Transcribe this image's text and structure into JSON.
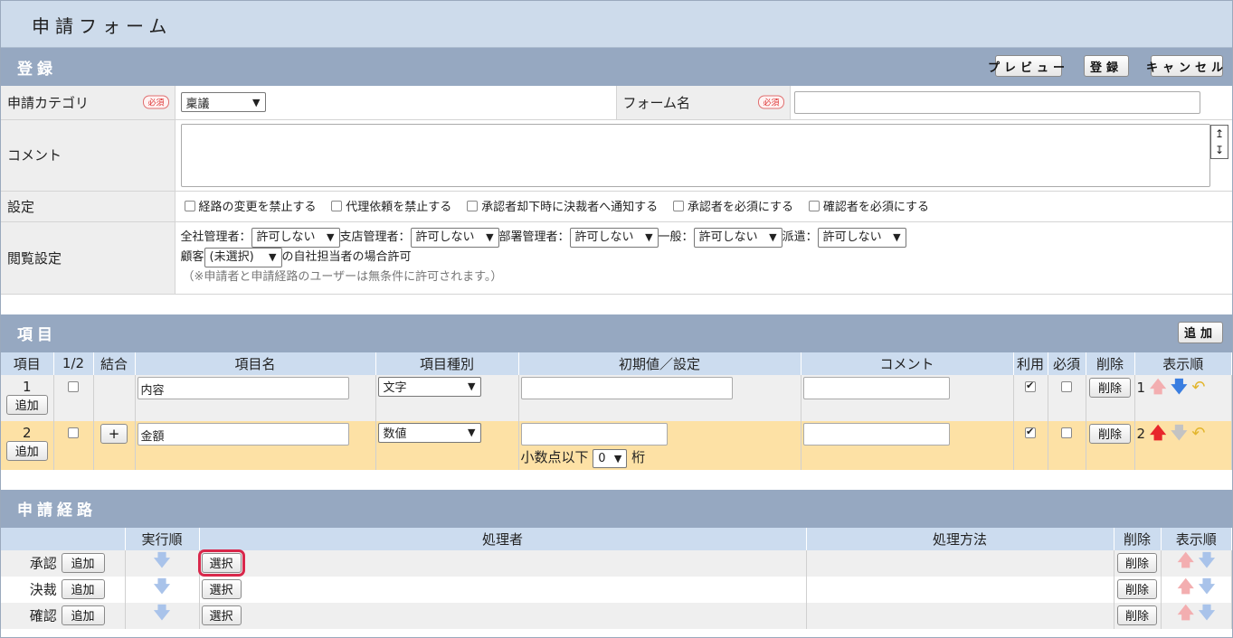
{
  "title": "申請フォーム",
  "register": {
    "heading": "登録",
    "buttons": {
      "preview": "プレビュー",
      "save": "登録",
      "cancel": "キャンセル"
    },
    "required_badge": "必須",
    "category_label": "申請カテゴリ",
    "category_value": "稟議",
    "form_name_label": "フォーム名",
    "form_name_value": "",
    "comment_label": "コメント",
    "comment_value": "",
    "settings_label": "設定",
    "settings": [
      "経路の変更を禁止する",
      "代理依頼を禁止する",
      "承認者却下時に決裁者へ通知する",
      "承認者を必須にする",
      "確認者を必須にする"
    ],
    "view_label": "閲覧設定",
    "view_roles": [
      {
        "label": "全社管理者：",
        "value": "許可しない"
      },
      {
        "label": "支店管理者：",
        "value": "許可しない"
      },
      {
        "label": "部署管理者：",
        "value": "許可しない"
      },
      {
        "label": "一般：",
        "value": "許可しない"
      },
      {
        "label": "派遣：",
        "value": "許可しない"
      }
    ],
    "customer_label": "顧客",
    "customer_value": "(未選択)",
    "customer_suffix": "の自社担当者の場合許可",
    "view_note": "（※申請者と申請経路のユーザーは無条件に許可されます。）"
  },
  "items": {
    "heading": "項目",
    "add_button": "追加",
    "columns": [
      "項目",
      "1/2",
      "結合",
      "項目名",
      "項目種別",
      "初期値／設定",
      "コメント",
      "利用",
      "必須",
      "削除",
      "表示順"
    ],
    "rows": [
      {
        "no": "1",
        "add": "追加",
        "name": "内容",
        "type": "文字",
        "delete": "削除",
        "order": "1"
      },
      {
        "no": "2",
        "add": "追加",
        "join": "+",
        "name": "金額",
        "type": "数値",
        "decimal_label": "小数点以下",
        "decimal_value": "0",
        "decimal_unit": "桁",
        "delete": "削除",
        "order": "2"
      }
    ]
  },
  "route": {
    "heading": "申請経路",
    "columns": [
      "",
      "実行順",
      "処理者",
      "処理方法",
      "削除",
      "表示順"
    ],
    "rows": [
      {
        "label": "承認",
        "add": "追加",
        "select": "選択",
        "delete": "削除"
      },
      {
        "label": "決裁",
        "add": "追加",
        "select": "選択",
        "delete": "削除"
      },
      {
        "label": "確認",
        "add": "追加",
        "select": "選択",
        "delete": "削除"
      }
    ]
  },
  "colors": {
    "title_bg": "#cddbeb",
    "section_bg": "#96a8c1",
    "header_row": "#ccdcef",
    "highlight_row": "#fde1a5",
    "highlight_border": "#d9284b"
  }
}
